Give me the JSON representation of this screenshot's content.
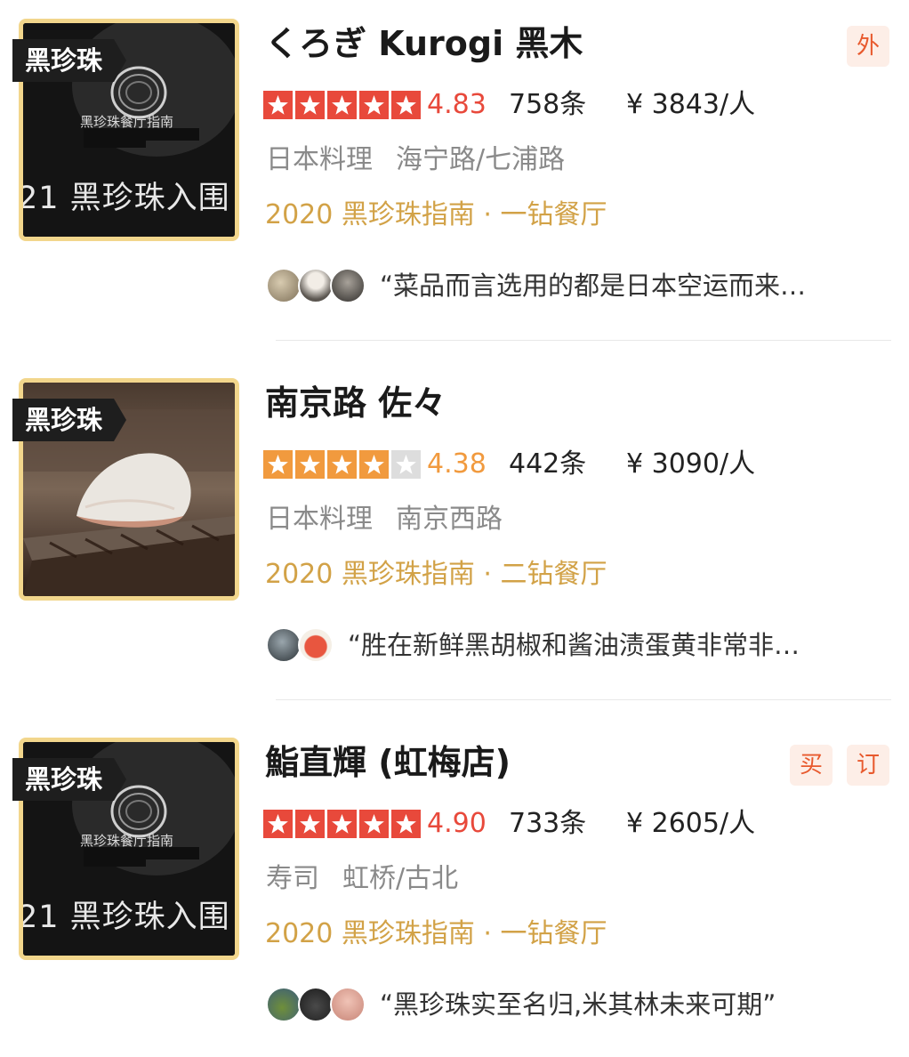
{
  "restaurants": [
    {
      "badge": "黑珍珠",
      "thumb_text": "21 黑珍珠入围",
      "thumb_caption": "黑珍珠餐厅指南",
      "name": "くろぎ Kurogi 黑木",
      "tags": [
        "外"
      ],
      "stars": 5,
      "star_color": "#e8493b",
      "score": "4.83",
      "score_color": "#e8493b",
      "review_count": "758条",
      "price": "¥ 3843/人",
      "cuisine": "日本料理",
      "area": "海宁路/七浦路",
      "award": "2020 黑珍珠指南 · 一钻餐厅",
      "review": "“菜品而言选用的都是日本空运而来…"
    },
    {
      "badge": "黑珍珠",
      "thumb_text": "",
      "thumb_caption": "",
      "name": "南京路 佐々",
      "tags": [],
      "stars": 4,
      "star_color": "#f19a3e",
      "score": "4.38",
      "score_color": "#f19a3e",
      "review_count": "442条",
      "price": "¥ 3090/人",
      "cuisine": "日本料理",
      "area": "南京西路",
      "award": "2020 黑珍珠指南 · 二钻餐厅",
      "review": "“胜在新鲜黑胡椒和酱油渍蛋黄非常非…"
    },
    {
      "badge": "黑珍珠",
      "thumb_text": "21 黑珍珠入围",
      "thumb_caption": "黑珍珠餐厅指南",
      "name": "鮨直輝 (虹梅店)",
      "tags": [
        "买",
        "订"
      ],
      "stars": 5,
      "star_color": "#e8493b",
      "score": "4.90",
      "score_color": "#e8493b",
      "review_count": "733条",
      "price": "¥ 2605/人",
      "cuisine": "寿司",
      "area": "虹桥/古北",
      "award": "2020 黑珍珠指南 · 一钻餐厅",
      "review": "“黑珍珠实至名归,米其林未来可期”"
    }
  ],
  "colors": {
    "accent_gold": "#d2a247",
    "frame_gold": "#f2d68c",
    "tag_bg": "#fdeee7",
    "tag_fg": "#e85a2e",
    "empty_star": "#dddddd"
  }
}
